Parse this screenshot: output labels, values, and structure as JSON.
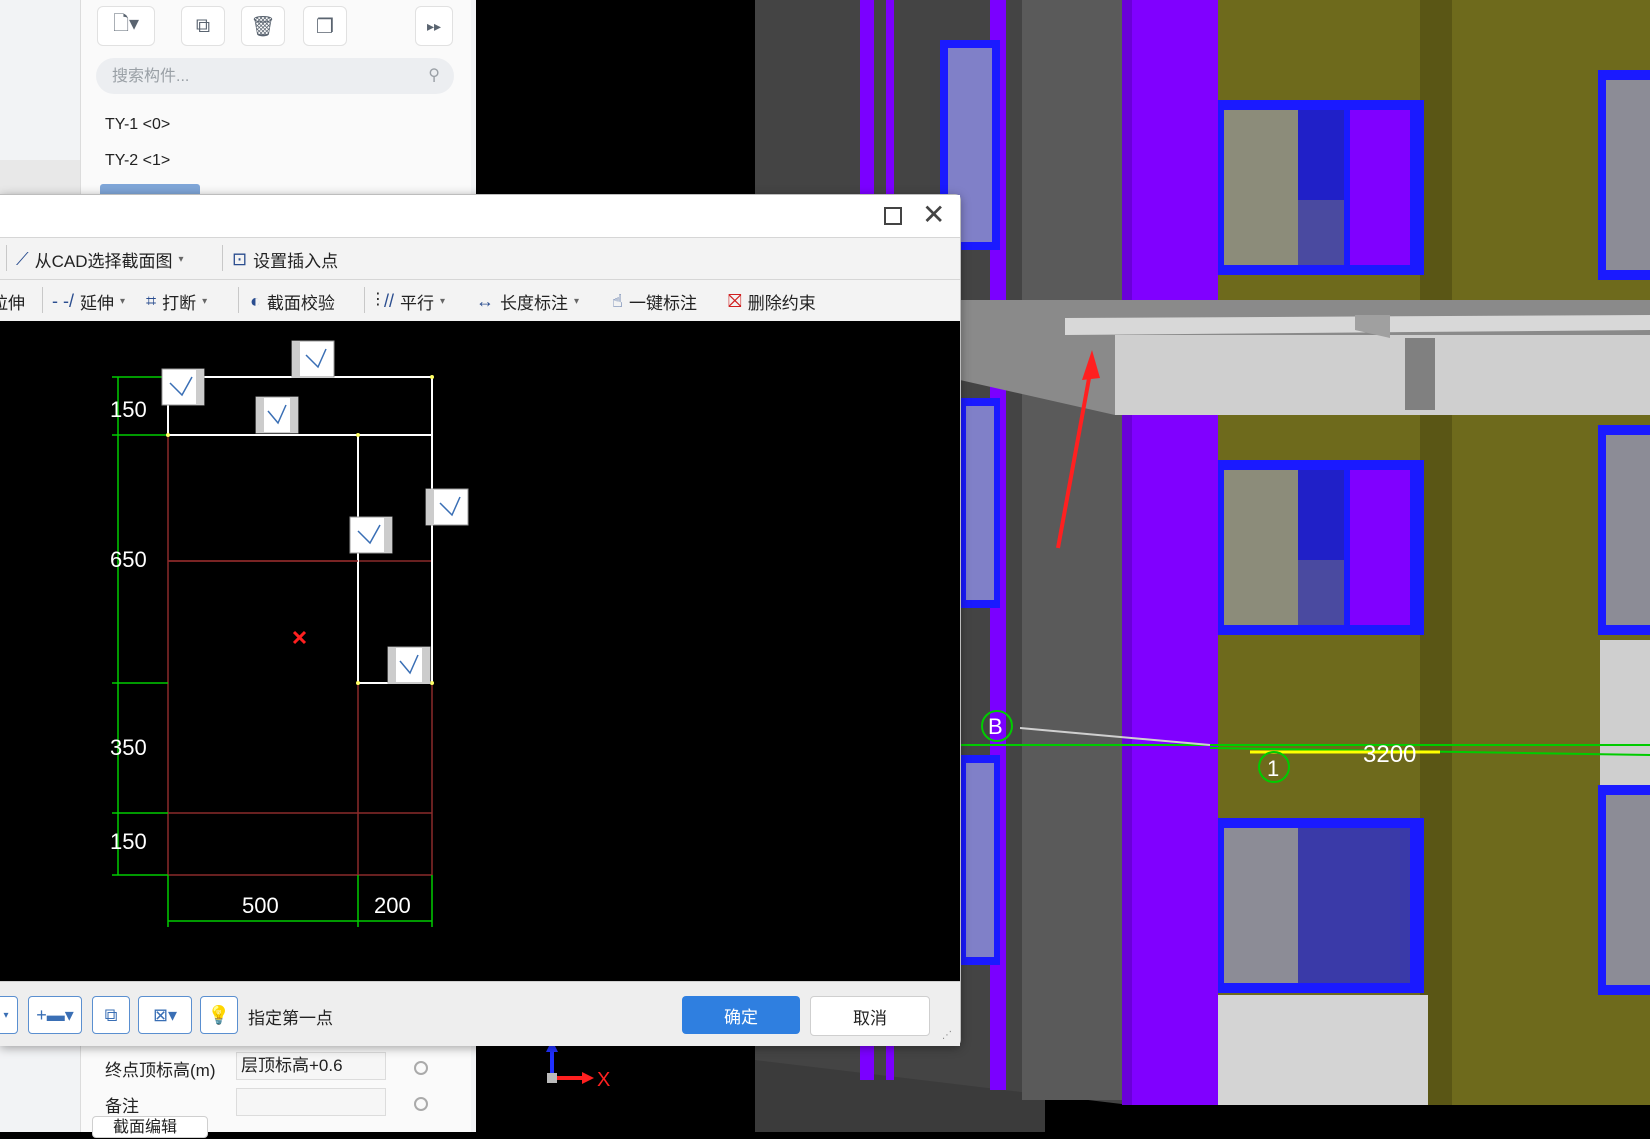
{
  "colors": {
    "wall_olive": "#6e6a1c",
    "column_purple": "#8000ff",
    "slab_gray": "#cfcfcf",
    "window_blue": "#1a1aff",
    "ok_blue": "#2f7fe0",
    "dim_green": "#00cc00",
    "section_red": "#8b2a2a"
  },
  "component_panel": {
    "search_placeholder": "搜索构件...",
    "items": [
      "TY-1 <0>",
      "TY-2 <1>"
    ],
    "toolbar_icons": [
      "new-component-icon",
      "copy-icon",
      "delete-icon",
      "duplicate-icon",
      "more-icon"
    ]
  },
  "properties": {
    "rows": [
      {
        "label": "终点顶标高(m)",
        "value": "层顶标高+0.6"
      },
      {
        "label": "备注",
        "value": ""
      }
    ],
    "section_edit_label": "截面编辑"
  },
  "dialog": {
    "toolbar1": {
      "cad_select_label": "从CAD选择截面图",
      "insert_point_label": "设置插入点"
    },
    "toolbar2": {
      "stretch_label": "拉伸",
      "extend_label": "延伸",
      "break_label": "打断",
      "section_check_label": "截面校验",
      "parallel_label": "平行",
      "length_dim_label": "长度标注",
      "one_key_dim_label": "一键标注",
      "delete_constraint_label": "删除约束"
    },
    "status_prompt": "指定第一点",
    "ok_label": "确定",
    "cancel_label": "取消",
    "dimensions": {
      "vertical": [
        "150",
        "650",
        "350",
        "150"
      ],
      "horizontal": [
        "500",
        "200"
      ]
    }
  },
  "viewport": {
    "axis_x_label": "X",
    "grid_label_b": "B",
    "grid_label_1": "1",
    "dimension_3200": "3200"
  }
}
